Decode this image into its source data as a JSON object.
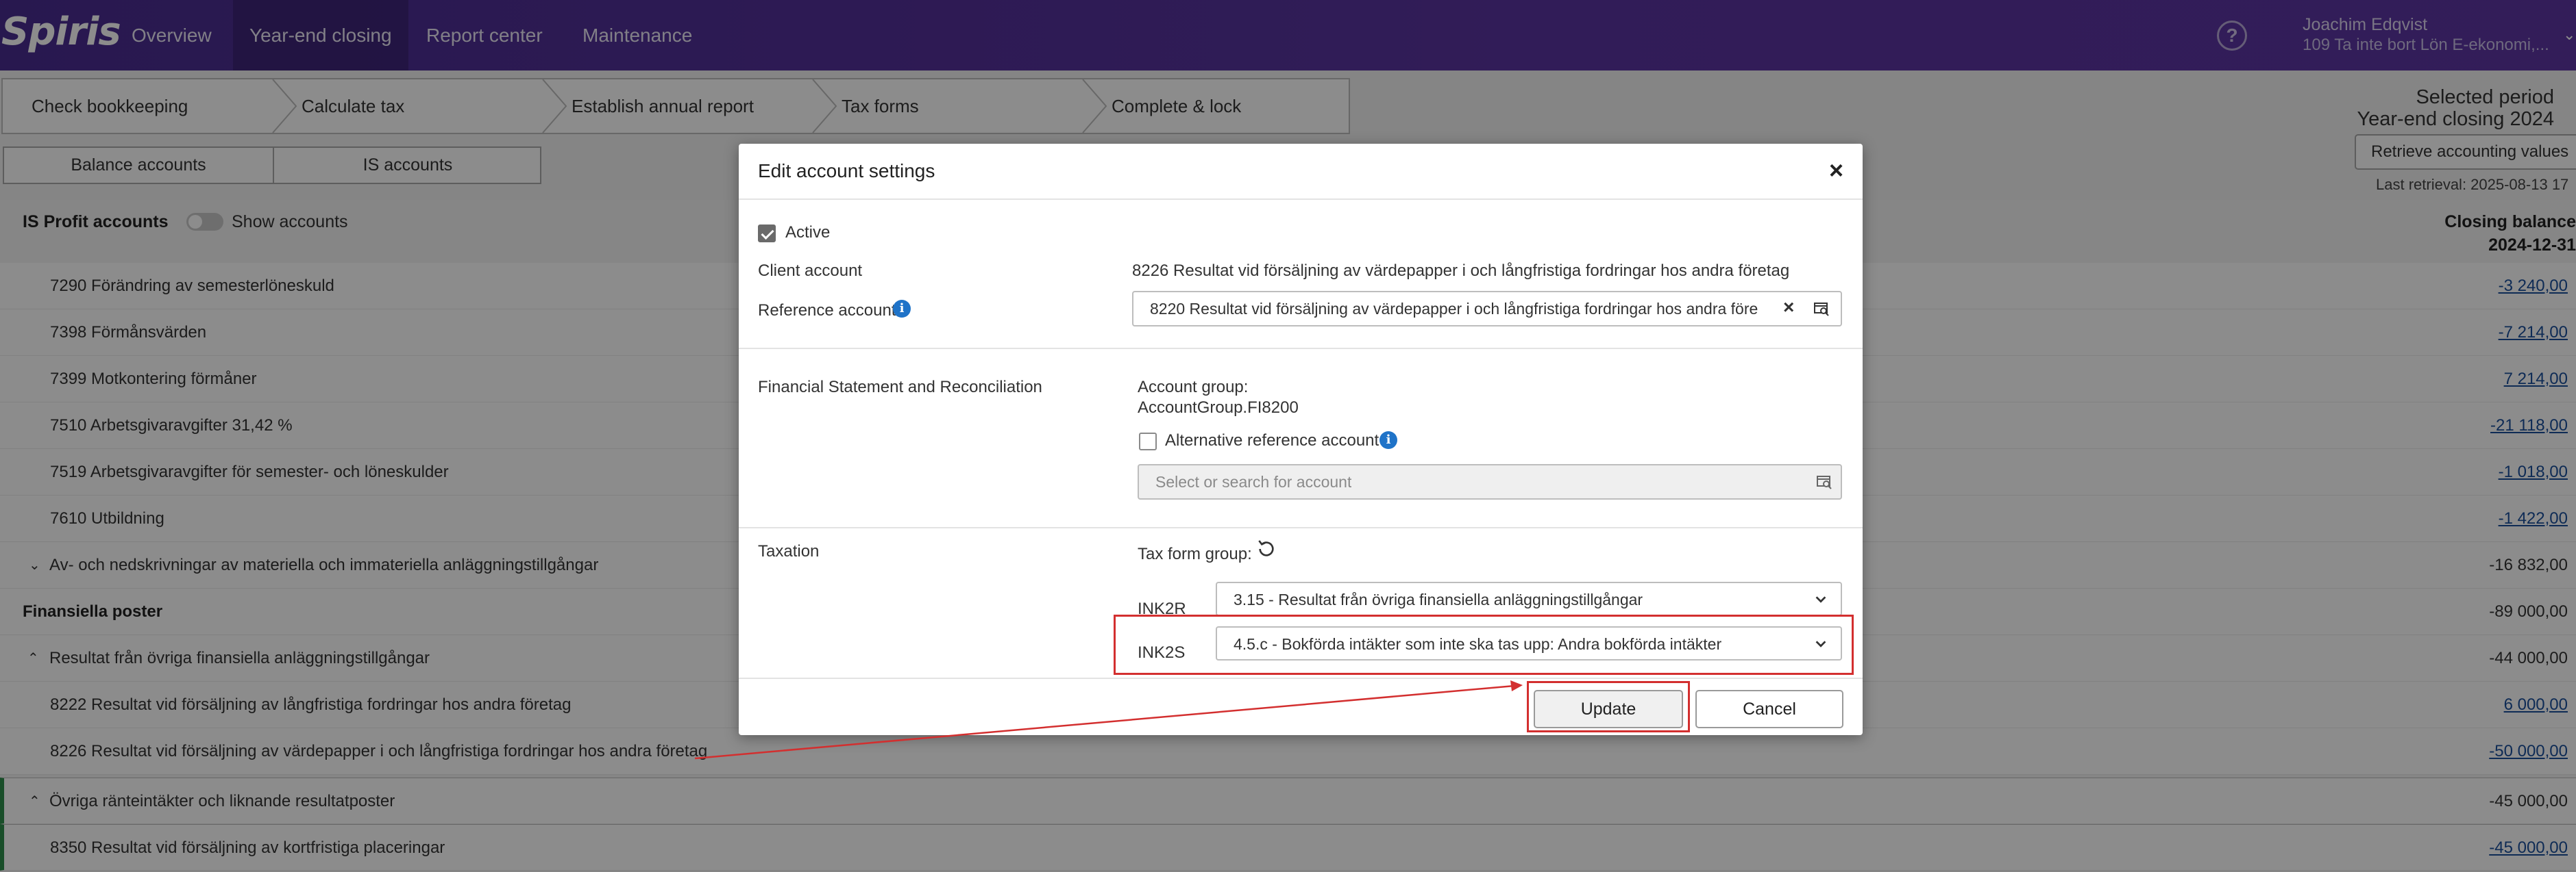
{
  "app": {
    "logo": "Spiris",
    "nav": [
      "Overview",
      "Year-end closing",
      "Report center",
      "Maintenance"
    ],
    "user_name": "Joachim Edqvist",
    "user_org": "109 Ta inte bort Lön E-ekonomi,..."
  },
  "steps": [
    "Check bookkeeping",
    "Calculate tax",
    "Establish annual report",
    "Tax forms",
    "Complete & lock"
  ],
  "period": {
    "label": "Selected period",
    "value": "Year-end closing 2024",
    "retrieve_button": "Retrieve accounting values",
    "last_retrieval": "Last retrieval: 2025-08-13 17"
  },
  "subtabs": [
    "Balance accounts",
    "IS accounts"
  ],
  "list": {
    "title": "IS Profit accounts",
    "show_accounts": "Show accounts",
    "col_title": "Closing balance",
    "col_date": "2024-12-31",
    "rows": [
      {
        "label": "7290 Förändring av semesterlöneskuld",
        "value": "-3 240,00"
      },
      {
        "label": "7398 Förmånsvärden",
        "value": "-7 214,00"
      },
      {
        "label": "7399 Motkontering förmåner",
        "value": "7 214,00"
      },
      {
        "label": "7510 Arbetsgivaravgifter 31,42 %",
        "value": "-21 118,00"
      },
      {
        "label": "7519 Arbetsgivaravgifter för semester- och löneskulder",
        "value": "-1 018,00"
      },
      {
        "label": "7610 Utbildning",
        "value": "-1 422,00"
      },
      {
        "label": "Av- och nedskrivningar av materiella och immateriella anläggningstillgångar",
        "value": "-16 832,00"
      },
      {
        "label": "Finansiella poster",
        "value": "-89 000,00"
      },
      {
        "label": "Resultat från övriga finansiella anläggningstillgångar",
        "value": "-44 000,00"
      },
      {
        "label": "8222 Resultat vid försäljning av långfristiga fordringar hos andra företag",
        "value": "6 000,00"
      },
      {
        "label": "8226 Resultat vid försäljning av värdepapper i och långfristiga fordringar hos andra företag",
        "value": "-50 000,00"
      },
      {
        "label": "Övriga ränteintäkter och liknande resultatposter",
        "value": "-45 000,00"
      },
      {
        "label": "8350 Resultat vid försäljning av kortfristiga placeringar",
        "value": "-45 000,00"
      }
    ]
  },
  "modal": {
    "title": "Edit account settings",
    "active_label": "Active",
    "client_account_label": "Client account",
    "client_account_value": "8226 Resultat vid försäljning av värdepapper i och långfristiga fordringar hos andra företag",
    "reference_account_label": "Reference account",
    "reference_account_value": "8220 Resultat vid försäljning av värdepapper i och långfristiga fordringar hos andra före",
    "fin_section_label": "Financial Statement and Reconciliation",
    "account_group_label": "Account group:",
    "account_group_value": "AccountGroup.FI8200",
    "alt_ref_label": "Alternative reference account",
    "alt_ref_placeholder": "Select or search for account",
    "tax_section_label": "Taxation",
    "tax_form_group_label": "Tax form group:",
    "ink2r_label": "INK2R",
    "ink2r_value": "3.15 - Resultat från övriga finansiella anläggningstillgångar",
    "ink2s_label": "INK2S",
    "ink2s_value": "4.5.c - Bokförda intäkter som inte ska tas upp: Andra bokförda intäkter",
    "update_button": "Update",
    "cancel_button": "Cancel"
  },
  "colors": {
    "topbar": "#4a2d91",
    "link": "#1a4f9c",
    "annotation": "#d32f2f",
    "info": "#1f73c8"
  }
}
